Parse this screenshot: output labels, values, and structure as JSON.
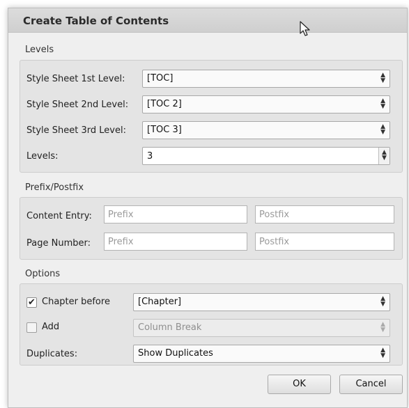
{
  "dialog": {
    "title": "Create Table of Contents"
  },
  "levels": {
    "section_label": "Levels",
    "rows": [
      {
        "label": "Style Sheet 1st Level:",
        "value": "[TOC]"
      },
      {
        "label": "Style Sheet 2nd Level:",
        "value": "[TOC 2]"
      },
      {
        "label": "Style Sheet 3rd Level:",
        "value": "[TOC 3]"
      }
    ],
    "levels_label": "Levels:",
    "levels_value": "3"
  },
  "prefix_postfix": {
    "section_label": "Prefix/Postfix",
    "content_entry_label": "Content Entry:",
    "page_number_label": "Page Number:",
    "prefix_placeholder": "Prefix",
    "postfix_placeholder": "Postfix"
  },
  "options": {
    "section_label": "Options",
    "chapter_before": {
      "checked": true,
      "check_glyph": "✔",
      "label": "Chapter before",
      "value": "[Chapter]"
    },
    "add": {
      "checked": false,
      "label": "Add",
      "value": "Column Break"
    },
    "duplicates": {
      "label": "Duplicates:",
      "value": "Show Duplicates"
    }
  },
  "buttons": {
    "ok": "OK",
    "cancel": "Cancel"
  },
  "icons": {
    "select_arrows": "updown-arrows-icon",
    "cursor": "mouse-pointer-icon"
  }
}
